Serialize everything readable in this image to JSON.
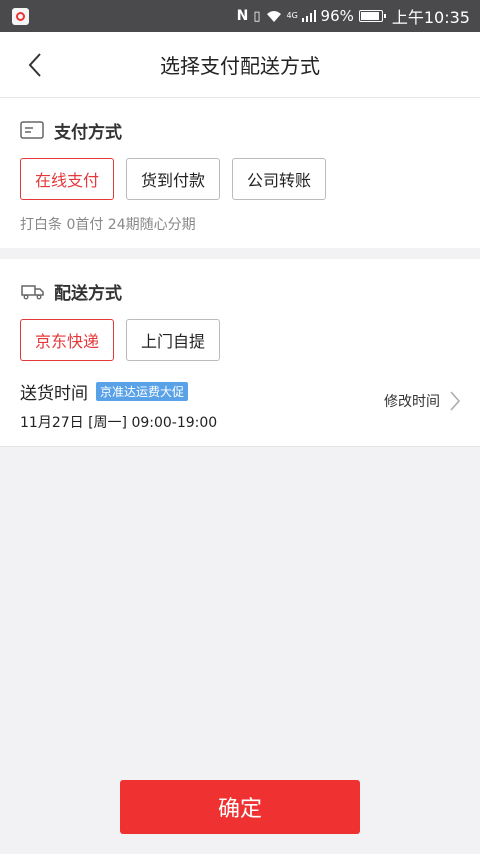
{
  "status_bar": {
    "network": "4G",
    "battery_percent": "96%",
    "time": "上午10:35"
  },
  "nav": {
    "title": "选择支付配送方式",
    "back_icon": "chevron-left-icon"
  },
  "payment": {
    "section_title": "支付方式",
    "icon": "card-icon",
    "options": [
      "在线支付",
      "货到付款",
      "公司转账"
    ],
    "selected": "在线支付",
    "note": "打白条 0首付 24期随心分期"
  },
  "delivery": {
    "section_title": "配送方式",
    "icon": "truck-icon",
    "options": [
      "京东快递",
      "上门自提"
    ],
    "selected": "京东快递",
    "time_label": "送货时间",
    "promo": "京准达运费大促",
    "time_value": "11月27日 [周一] 09:00-19:00",
    "modify_label": "修改时间"
  },
  "confirm_label": "确定",
  "colors": {
    "accent": "#e4393c",
    "confirm_bg": "#ef3131",
    "promo_bg": "#5aa2e8"
  }
}
